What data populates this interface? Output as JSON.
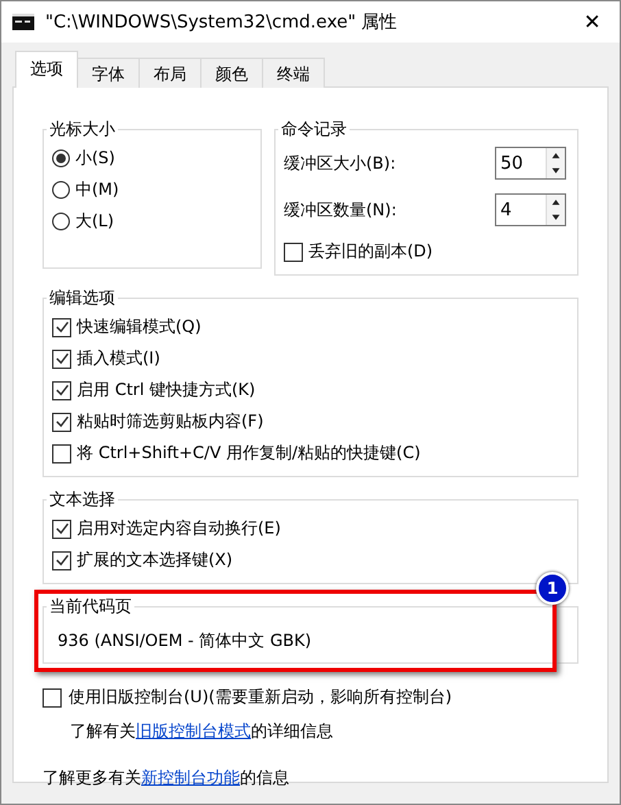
{
  "window": {
    "title": "\"C:\\WINDOWS\\System32\\cmd.exe\" 属性",
    "close": "✕"
  },
  "tabs": [
    {
      "label": "选项",
      "selected": true
    },
    {
      "label": "字体",
      "selected": false
    },
    {
      "label": "布局",
      "selected": false
    },
    {
      "label": "颜色",
      "selected": false
    },
    {
      "label": "终端",
      "selected": false
    }
  ],
  "cursor_size": {
    "title": "光标大小",
    "options": [
      {
        "label": "小(S)",
        "selected": true
      },
      {
        "label": "中(M)",
        "selected": false
      },
      {
        "label": "大(L)",
        "selected": false
      }
    ]
  },
  "command_history": {
    "title": "命令记录",
    "spinners": [
      {
        "label": "缓冲区大小(B):",
        "value": "50"
      },
      {
        "label": "缓冲区数量(N):",
        "value": "4"
      }
    ],
    "discard": {
      "label": "丢弃旧的副本(D)",
      "checked": false
    }
  },
  "edit_options": {
    "title": "编辑选项",
    "items": [
      {
        "label": "快速编辑模式(Q)",
        "checked": true
      },
      {
        "label": "插入模式(I)",
        "checked": true
      },
      {
        "label": "启用 Ctrl 键快捷方式(K)",
        "checked": true
      },
      {
        "label": "粘贴时筛选剪贴板内容(F)",
        "checked": true
      },
      {
        "label": "将 Ctrl+Shift+C/V 用作复制/粘贴的快捷键(C)",
        "checked": false
      }
    ]
  },
  "text_selection": {
    "title": "文本选择",
    "items": [
      {
        "label": "启用对选定内容自动换行(E)",
        "checked": true
      },
      {
        "label": "扩展的文本选择键(X)",
        "checked": true
      }
    ]
  },
  "code_page": {
    "title": "当前代码页",
    "value": "936   (ANSI/OEM - 简体中文 GBK)",
    "annotation": "1"
  },
  "legacy": {
    "label": "使用旧版控制台(U)(需要重新启动，影响所有控制台)",
    "checked": false
  },
  "legacy_info": {
    "before": "了解有关",
    "link": "旧版控制台模式",
    "after": "的详细信息"
  },
  "more_info": {
    "before": "了解更多有关",
    "link": "新控制台功能",
    "after": "的信息"
  }
}
